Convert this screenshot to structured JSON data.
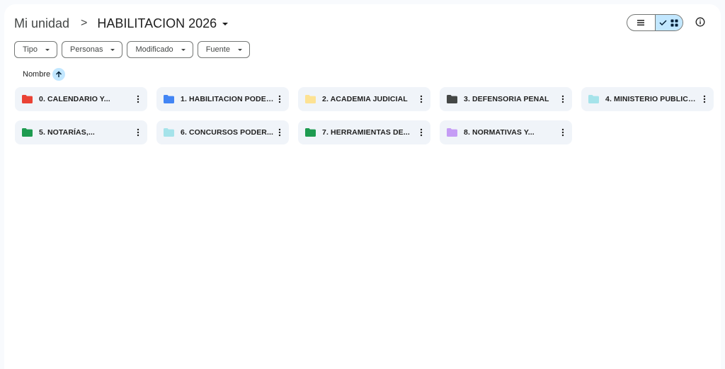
{
  "breadcrumb": {
    "root": "Mi unidad",
    "separator": ">",
    "current": "HABILITACION 2026"
  },
  "view_toggle": {
    "list_icon": "list-icon",
    "grid_icon": "grid-icon",
    "check_icon": "check-icon",
    "selected": "grid"
  },
  "info_icon": "info-icon",
  "filters": [
    {
      "label": "Tipo"
    },
    {
      "label": "Personas"
    },
    {
      "label": "Modificado"
    },
    {
      "label": "Fuente"
    }
  ],
  "sort": {
    "label": "Nombre",
    "icon": "arrow-up-icon"
  },
  "folders": [
    {
      "name": "0. CALENDARIO Y...",
      "color": "#ea4335"
    },
    {
      "name": "1. HABILITACION PODER...",
      "color": "#4285f4"
    },
    {
      "name": "2. ACADEMIA JUDICIAL",
      "color": "#fde293"
    },
    {
      "name": "3. DEFENSORIA PENAL",
      "color": "#444746"
    },
    {
      "name": "4. MINISTERIO PUBLICO ...",
      "color": "#a5e3ea"
    },
    {
      "name": "5. NOTARÍAS,...",
      "color": "#1e9b50"
    },
    {
      "name": "6. CONCURSOS PODER...",
      "color": "#a5e3ea"
    },
    {
      "name": "7. HERRAMIENTAS DE...",
      "color": "#1e9b50"
    },
    {
      "name": "8. NORMATIVAS Y...",
      "color": "#c59cf5"
    }
  ]
}
